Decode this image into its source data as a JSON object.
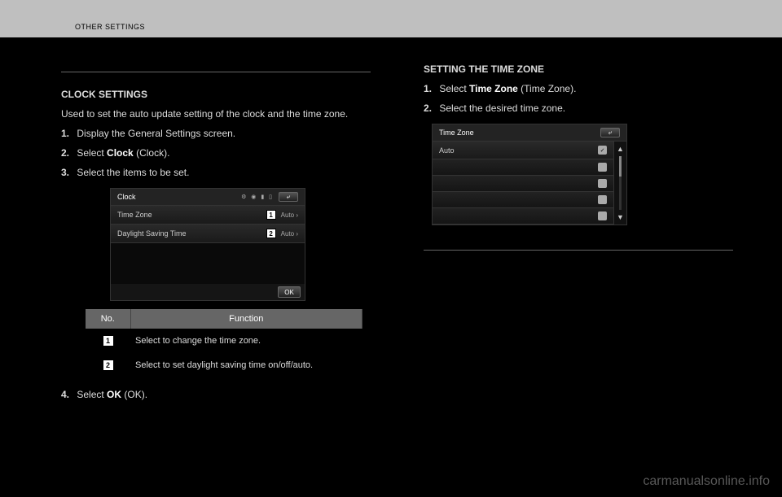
{
  "header": {
    "section": "OTHER SETTINGS"
  },
  "left": {
    "heading": "CLOCK SETTINGS",
    "intro": "Used to set the auto update setting of the clock and the time zone.",
    "step1_prefix": "1.",
    "step1_before": "Display the General Settings screen.",
    "step2_prefix": "2.",
    "step2_a": "Select ",
    "step2_bold": "Clock",
    "step2_b": " (Clock).",
    "step3_prefix": "3.",
    "step3": "Select the items to be set.",
    "clock_ss": {
      "title": "Clock",
      "row1": "Time Zone",
      "row1_val": "Auto ›",
      "row2": "Daylight Saving Time",
      "row2_val": "Auto ›",
      "ok": "OK",
      "back": "⤶"
    },
    "table": {
      "no_hdr": "No.",
      "fn_hdr": "Function",
      "fn1": "Select to change the time zone.",
      "fn2": "Select to set daylight saving time on/off/auto."
    },
    "step4_prefix": "4.",
    "step4_a": "Select ",
    "step4_bold": "OK",
    "step4_b": " (OK)."
  },
  "right": {
    "tz_heading": "SETTING THE TIME ZONE",
    "step1_prefix": "1.",
    "step1_a": "Select ",
    "step1_bold": "Time Zone",
    "step1_b": " (Time Zone).",
    "step2_prefix": "2.",
    "step2": "Select the desired time zone.",
    "tz_ss": {
      "title": "Time Zone",
      "item1": "Auto",
      "back": "⤶"
    }
  },
  "watermark": "carmanualsonline.info"
}
